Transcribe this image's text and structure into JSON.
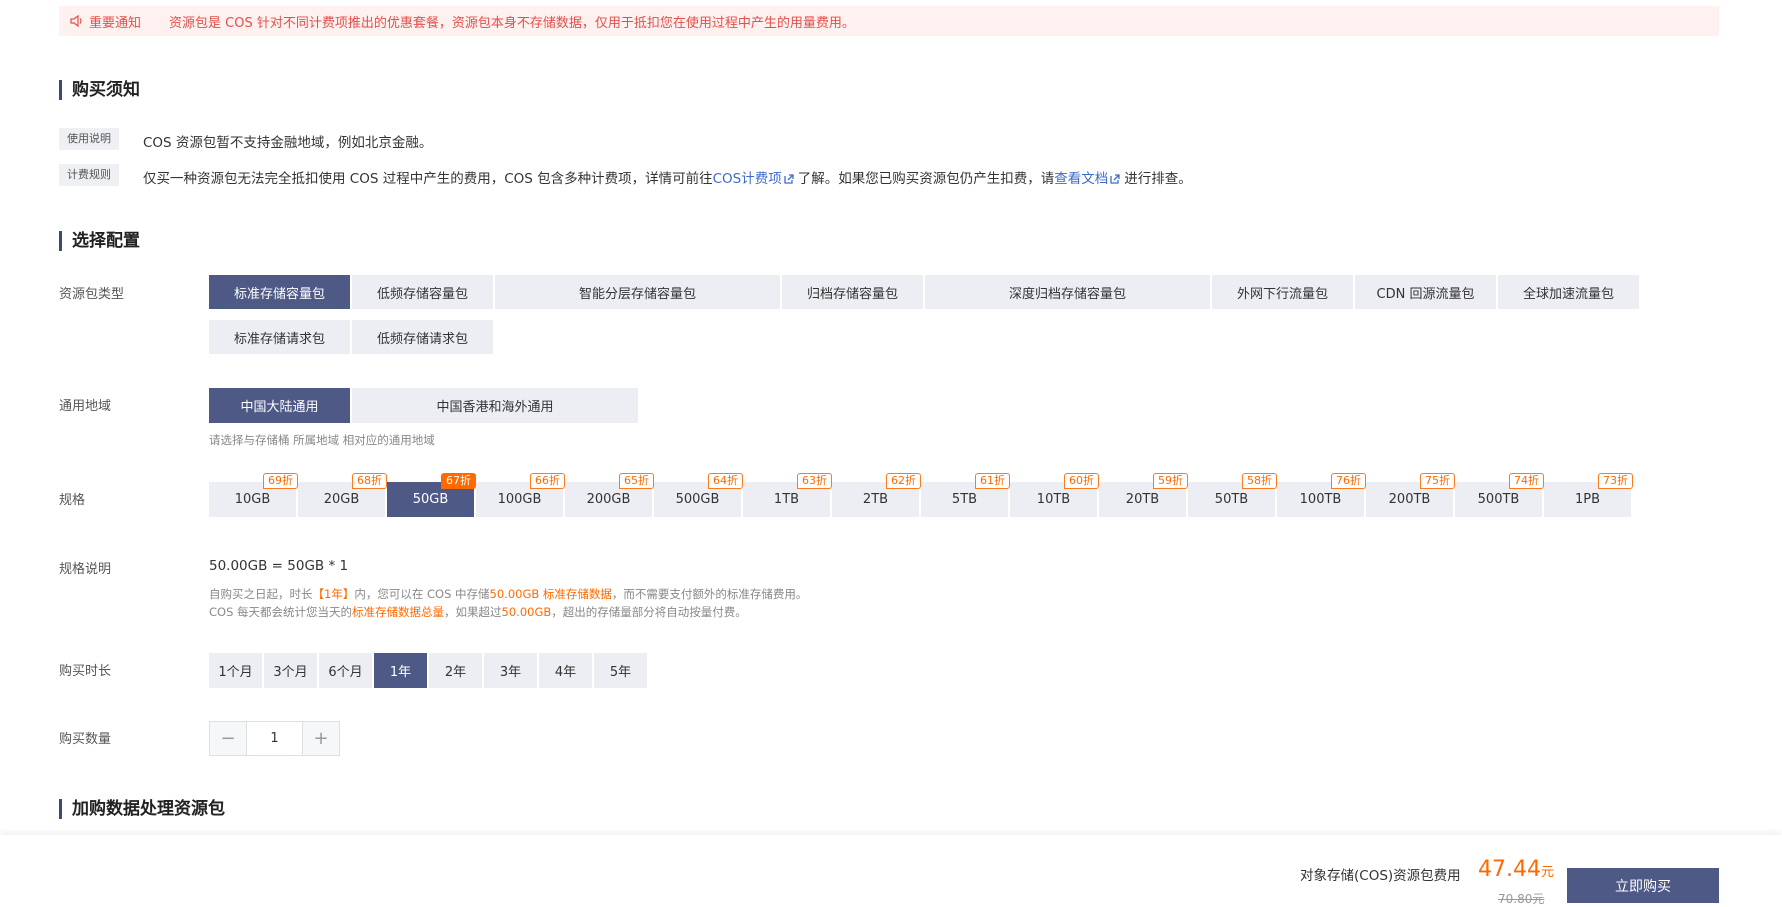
{
  "notice": {
    "title": "重要通知",
    "text": "资源包是 COS 针对不同计费项推出的优惠套餐，资源包本身不存储数据，仅用于抵扣您在使用过程中产生的用量费用。",
    "icon": "speaker-icon"
  },
  "purchase_notes": {
    "title": "购买须知",
    "items": [
      {
        "tag": "使用说明",
        "text": "COS 资源包暂不支持金融地域，例如北京金融。"
      },
      {
        "tag": "计费规则",
        "text_before": "仅买一种资源包无法完全抵扣使用 COS 过程中产生的费用，COS 包含多种计费项，详情可前往",
        "link1": "COS计费项",
        "text_mid": "了解。如果您已购买资源包仍产生扣费，请",
        "link2": "查看文档",
        "text_after": "进行排查。"
      }
    ]
  },
  "config": {
    "title": "选择配置",
    "package_type": {
      "label": "资源包类型",
      "options": [
        "标准存储容量包",
        "低频存储容量包",
        "智能分层存储容量包",
        "归档存储容量包",
        "深度归档存储容量包",
        "外网下行流量包",
        "CDN 回源流量包",
        "全球加速流量包",
        "标准存储请求包",
        "低频存储请求包"
      ],
      "selected": "标准存储容量包"
    },
    "region": {
      "label": "通用地域",
      "options": [
        "中国大陆通用",
        "中国香港和海外通用"
      ],
      "selected": "中国大陆通用",
      "hint": "请选择与存储桶 所属地域 相对应的通用地域"
    },
    "spec": {
      "label": "规格",
      "options": [
        {
          "size": "10GB",
          "discount": "69折"
        },
        {
          "size": "20GB",
          "discount": "68折"
        },
        {
          "size": "50GB",
          "discount": "67折"
        },
        {
          "size": "100GB",
          "discount": "66折"
        },
        {
          "size": "200GB",
          "discount": "65折"
        },
        {
          "size": "500GB",
          "discount": "64折"
        },
        {
          "size": "1TB",
          "discount": "63折"
        },
        {
          "size": "2TB",
          "discount": "62折"
        },
        {
          "size": "5TB",
          "discount": "61折"
        },
        {
          "size": "10TB",
          "discount": "60折"
        },
        {
          "size": "20TB",
          "discount": "59折"
        },
        {
          "size": "50TB",
          "discount": "58折"
        },
        {
          "size": "100TB",
          "discount": "76折"
        },
        {
          "size": "200TB",
          "discount": "75折"
        },
        {
          "size": "500TB",
          "discount": "74折"
        },
        {
          "size": "1PB",
          "discount": "73折"
        }
      ],
      "selected": "50GB"
    },
    "spec_desc": {
      "label": "规格说明",
      "formula": "50.00GB = 50GB * 1",
      "note1_a": "自购买之日起，时长",
      "note1_dur": "【1年】",
      "note1_b": "内，您可以在 COS 中存储",
      "note1_amt": "50.00GB 标准存储数据",
      "note1_c": "，而不需要支付额外的标准存储费用。",
      "note2_a": "COS 每天都会统计您当天的",
      "note2_hl": "标准存储数据总量",
      "note2_b": "，如果超过",
      "note2_amt": "50.00GB",
      "note2_c": "，超出的存储量部分将自动按量付费。"
    },
    "duration": {
      "label": "购买时长",
      "options": [
        "1个月",
        "3个月",
        "6个月",
        "1年",
        "2年",
        "3年",
        "4年",
        "5年"
      ],
      "selected": "1年"
    },
    "quantity": {
      "label": "购买数量",
      "value": "1",
      "minus": "−",
      "plus": "+"
    }
  },
  "addon": {
    "title": "加购数据处理资源包"
  },
  "footer": {
    "label": "对象存储(COS)资源包费用",
    "price": "47.44",
    "unit": "元",
    "original": "70.80元",
    "buy_label": "立即购买"
  },
  "colors": {
    "accent": "#4e5a85",
    "price": "#ff6a00",
    "notice_bg": "#fff1f0",
    "link": "#3d6bc8"
  }
}
